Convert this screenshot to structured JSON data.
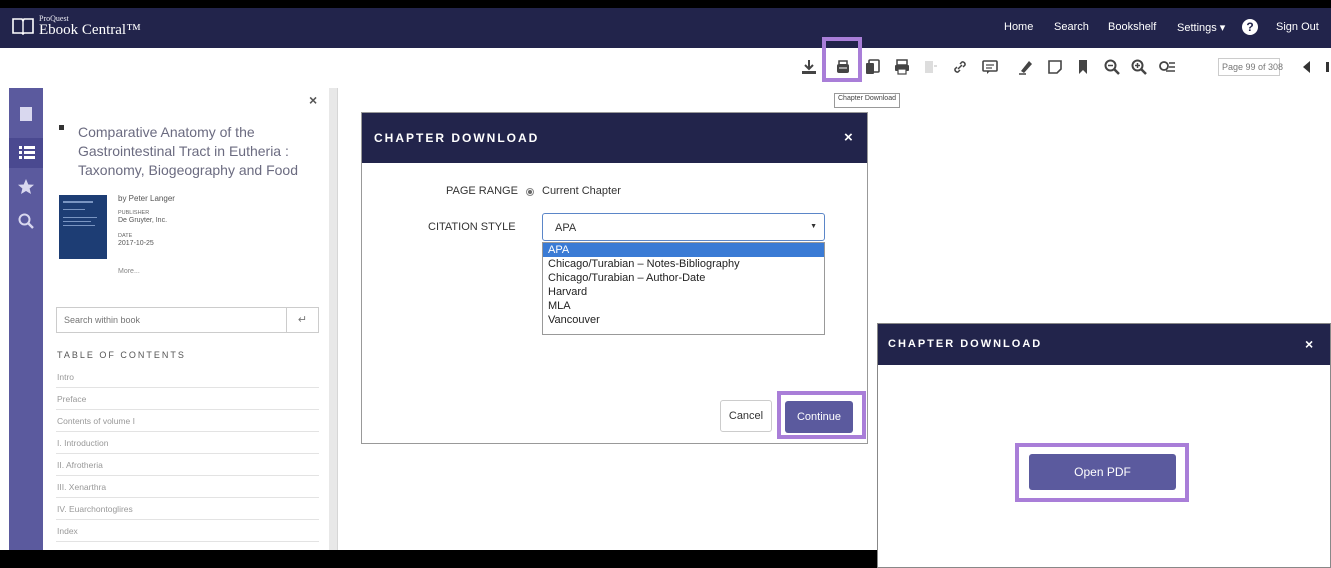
{
  "header": {
    "brand_small": "ProQuest",
    "brand_name": "Ebook Central™",
    "nav": {
      "home": "Home",
      "search": "Search",
      "bookshelf": "Bookshelf",
      "settings": "Settings ▾",
      "sign_out": "Sign Out"
    }
  },
  "toolbar": {
    "tooltip": "Chapter Download",
    "page_indicator": "Page 99 of 308"
  },
  "side_panel": {
    "book_title": "Comparative Anatomy of the Gastrointestinal Tract in Eutheria : Taxonomy, Biogeography and Food",
    "author": "by Peter Langer",
    "publisher_label": "PUBLISHER",
    "publisher": "De Gruyter, Inc.",
    "date_label": "DATE",
    "date": "2017-10-25",
    "more": "More...",
    "search_placeholder": "Search within book",
    "toc_heading": "TABLE OF CONTENTS",
    "toc": [
      "Intro",
      "Preface",
      "Contents of volume I",
      "I. Introduction",
      "II. Afrotheria",
      "III. Xenarthra",
      "IV. Euarchontoglires",
      "Index"
    ]
  },
  "chapter_download_modal": {
    "title": "CHAPTER DOWNLOAD",
    "page_range_label": "PAGE RANGE",
    "page_range_value": "Current Chapter",
    "citation_label": "CITATION STYLE",
    "citation_selected": "APA",
    "citation_options": [
      "APA",
      "Chicago/Turabian – Notes-Bibliography",
      "Chicago/Turabian – Author-Date",
      "Harvard",
      "MLA",
      "Vancouver"
    ],
    "cancel": "Cancel",
    "continue": "Continue"
  },
  "open_pdf_modal": {
    "title": "CHAPTER DOWNLOAD",
    "open_pdf": "Open PDF"
  },
  "colors": {
    "navy": "#22244b",
    "purple": "#5b5a9e",
    "highlight": "#a97ed8",
    "selected_option": "#3a7bd5"
  }
}
